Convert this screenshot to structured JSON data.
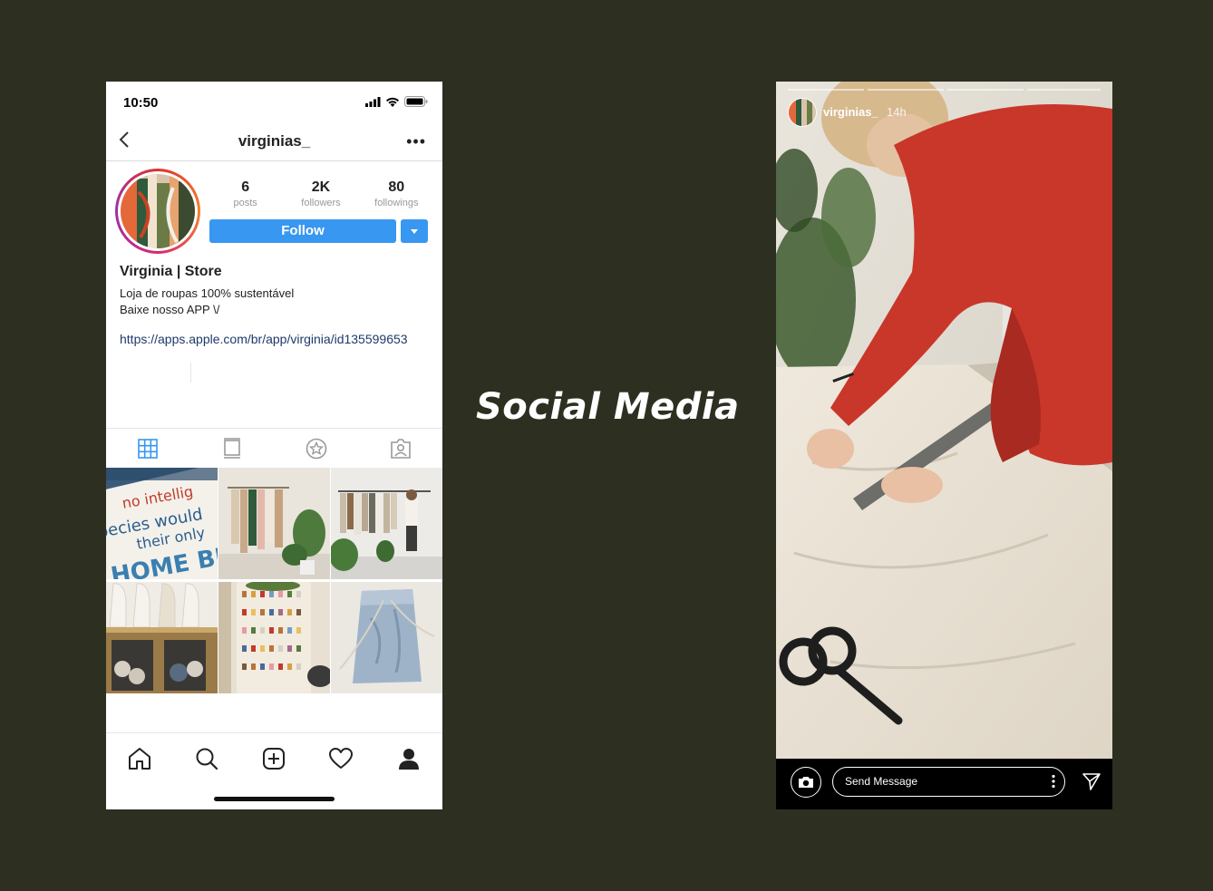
{
  "title": "Social Media",
  "profile": {
    "status_time": "10:50",
    "username": "virginias_",
    "stats": [
      {
        "value": "6",
        "label": "posts"
      },
      {
        "value": "2K",
        "label": "followers"
      },
      {
        "value": "80",
        "label": "followings"
      }
    ],
    "follow_label": "Follow",
    "bio_name": "Virginia | Store",
    "bio_line1": "Loja de roupas 100% sustentável",
    "bio_line2": "Baixe nosso APP \\/",
    "bio_link": "https://apps.apple.com/br/app/virginia/id135599653",
    "tabs": [
      "grid-icon",
      "feed-icon",
      "star-icon",
      "tagged-icon"
    ],
    "posts": [
      "protest-sign-photo",
      "clothing-rack-photo",
      "store-interior-photo",
      "mannequins-photo",
      "thread-wall-photo",
      "denim-bag-photo"
    ],
    "poster_text": [
      "no intellig",
      "pecies would",
      "their only",
      "HOME BE"
    ],
    "bottom_nav": [
      "home-icon",
      "search-icon",
      "add-post-icon",
      "heart-icon",
      "profile-icon"
    ]
  },
  "story": {
    "username": "virginias_",
    "time_ago": "14h",
    "message_placeholder": "Send Message",
    "progress_segments": 4
  },
  "colors": {
    "background": "#2d3021",
    "follow_button": "#3897f0",
    "link": "#1f3a6b",
    "story_bar": "#000000"
  }
}
